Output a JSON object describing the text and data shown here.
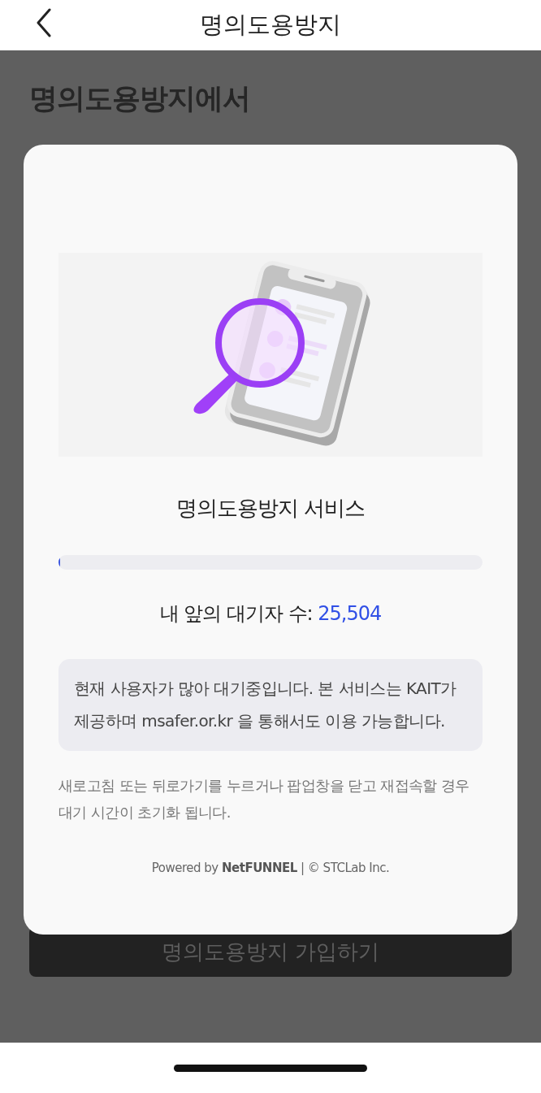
{
  "header": {
    "title": "명의도용방지"
  },
  "page": {
    "headline": [
      "명의도용방지에서"
    ],
    "join_button": "명의도용방지 가입하기"
  },
  "modal": {
    "service_title": "명의도용방지 서비스",
    "progress": {
      "level": 0.004
    },
    "queue_label": "내 앞의 대기자 수:",
    "queue_count": "25,504",
    "message": "현재 사용자가 많아 대기중입니다. 본 서비스는 KAIT가 제공하며 msafer.or.kr 을 통해서도 이용 가능합니다.",
    "note": "새로고침 또는 뒤로가기를 누르거나 팝업창을 닫고 재접속할 경우 대기 시간이 초기화 됩니다.",
    "footer": "Powered by **NetFUNNEL** | © STCLab Inc."
  }
}
